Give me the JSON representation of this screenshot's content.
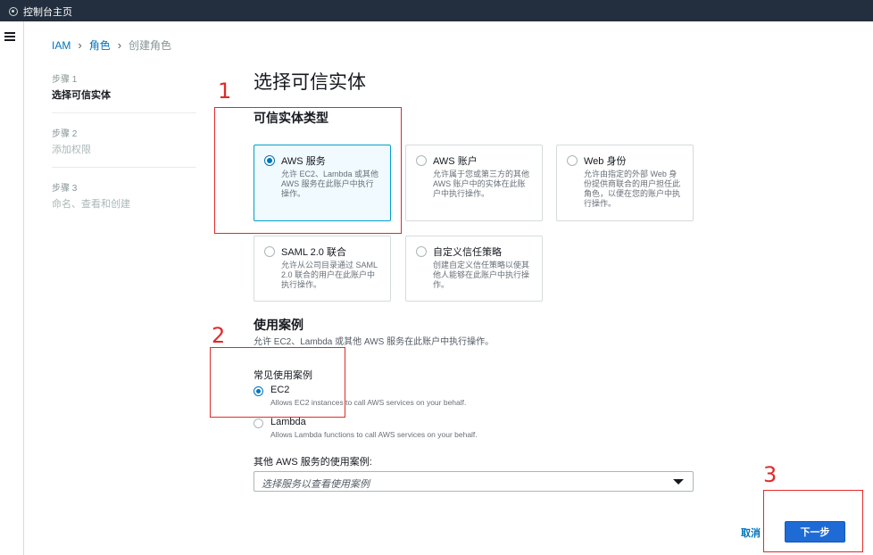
{
  "topbar": {
    "home_label": "控制台主页"
  },
  "breadcrumb": {
    "iam": "IAM",
    "roles": "角色",
    "create_role": "创建角色"
  },
  "steps": [
    {
      "num": "步骤 1",
      "title": "选择可信实体"
    },
    {
      "num": "步骤 2",
      "title": "添加权限"
    },
    {
      "num": "步骤 3",
      "title": "命名、查看和创建"
    }
  ],
  "page_title": "选择可信实体",
  "entity_section": {
    "title": "可信实体类型",
    "tiles": [
      {
        "title": "AWS 服务",
        "desc": "允许 EC2、Lambda 或其他 AWS 服务在此账户中执行操作。",
        "selected": true
      },
      {
        "title": "AWS 账户",
        "desc": "允许属于您或第三方的其他 AWS 账户中的实体在此账户中执行操作。",
        "selected": false
      },
      {
        "title": "Web 身份",
        "desc": "允许由指定的外部 Web 身份提供商联合的用户担任此角色，以便在您的账户中执行操作。",
        "selected": false
      },
      {
        "title": "SAML 2.0 联合",
        "desc": "允许从公司目录通过 SAML 2.0 联合的用户在此账户中执行操作。",
        "selected": false
      },
      {
        "title": "自定义信任策略",
        "desc": "创建自定义信任策略以使其他人能够在此账户中执行操作。",
        "selected": false
      }
    ]
  },
  "usecase_section": {
    "title": "使用案例",
    "subtitle": "允许 EC2、Lambda 或其他 AWS 服务在此账户中执行操作。",
    "common_label": "常见使用案例",
    "options": [
      {
        "title": "EC2",
        "desc": "Allows EC2 instances to call AWS services on your behalf.",
        "selected": true
      },
      {
        "title": "Lambda",
        "desc": "Allows Lambda functions to call AWS services on your behalf.",
        "selected": false
      }
    ],
    "other_label": "其他 AWS 服务的使用案例:",
    "select_placeholder": "选择服务以查看使用案例"
  },
  "footer": {
    "cancel_label": "取消",
    "next_label": "下一步"
  },
  "annotations": [
    {
      "label": "1"
    },
    {
      "label": "2"
    },
    {
      "label": "3"
    }
  ],
  "colors": {
    "accent": "#0073bb",
    "annotation": "#e02a2a",
    "topbar": "#232f3e",
    "primary_button": "#1e6bd6"
  }
}
